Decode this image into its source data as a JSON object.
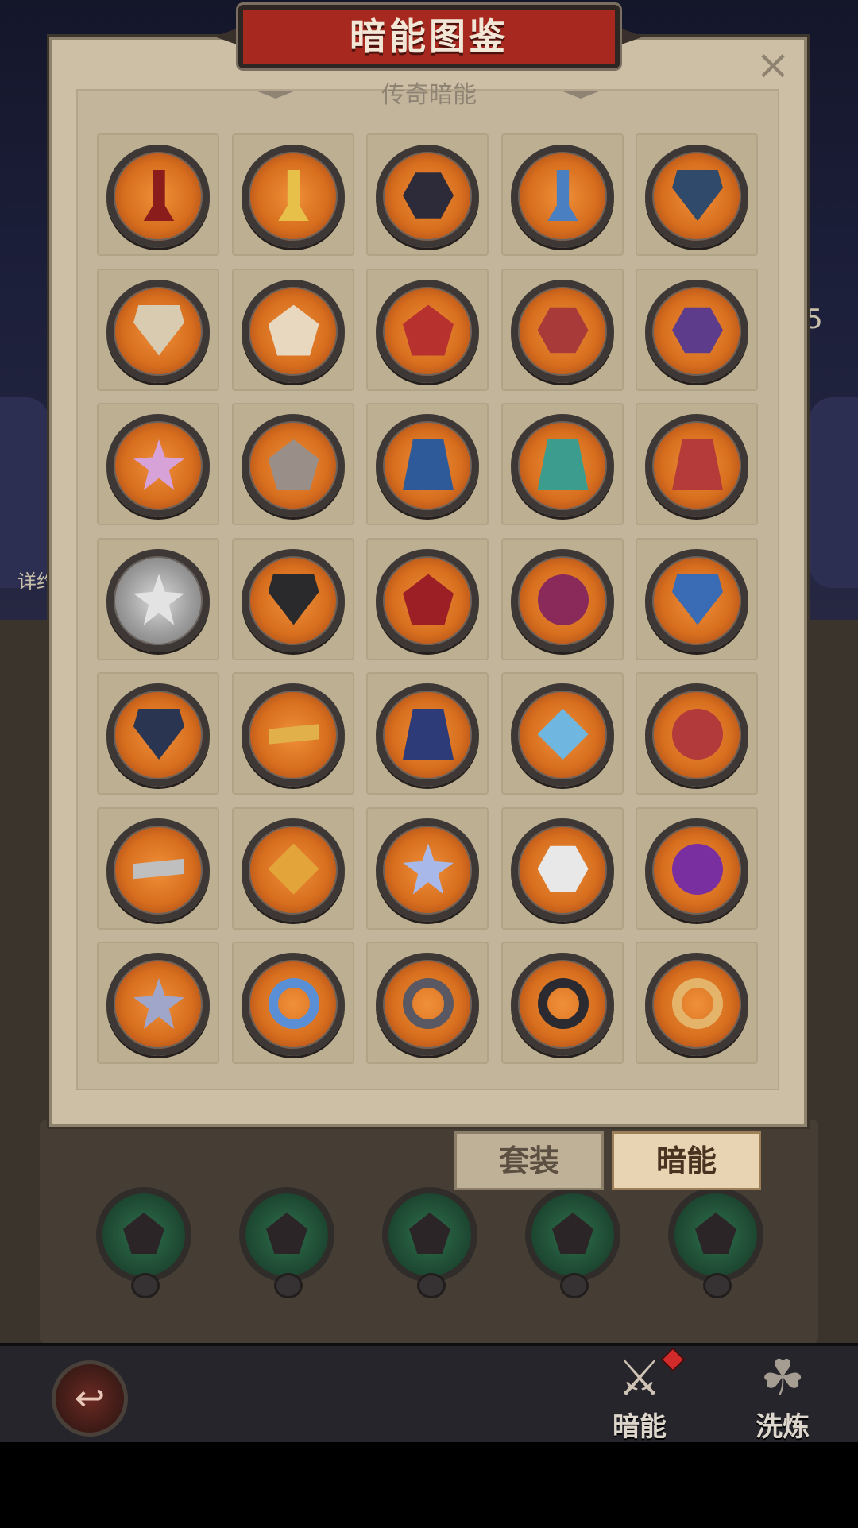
{
  "dialog": {
    "title": "暗能图鉴",
    "close_symbol": "×",
    "section_title": "传奇暗能"
  },
  "background": {
    "left_label": "详约",
    "right_label": "5"
  },
  "tabs": [
    {
      "label": "套装",
      "active": false
    },
    {
      "label": "暗能",
      "active": true
    }
  ],
  "bottom_nav": [
    {
      "label": "暗能",
      "icon": "dark-energy-icon",
      "active": true,
      "badge": true
    },
    {
      "label": "洗炼",
      "icon": "refine-icon",
      "active": false,
      "badge": false
    }
  ],
  "back_button": {
    "icon": "back-arrow-icon"
  },
  "grid": {
    "columns": 5,
    "rows": 7,
    "items": [
      {
        "name": "scepter",
        "shape": "tall",
        "color": "#8a1c1c",
        "badge": "orange"
      },
      {
        "name": "gold-key",
        "shape": "tall",
        "color": "#e7c04a",
        "badge": "orange"
      },
      {
        "name": "double-axe",
        "shape": "hex",
        "color": "#2d2a3a",
        "badge": "orange"
      },
      {
        "name": "sword",
        "shape": "tall",
        "color": "#4a7fc1",
        "badge": "orange"
      },
      {
        "name": "dark-helm",
        "shape": "shield",
        "color": "#2f4a6a",
        "badge": "orange"
      },
      {
        "name": "winged-helm",
        "shape": "shield",
        "color": "#d8cbb0",
        "badge": "orange"
      },
      {
        "name": "bone-mask",
        "shape": "pent",
        "color": "#e8d8c0",
        "badge": "orange"
      },
      {
        "name": "demon-mask",
        "shape": "pent",
        "color": "#b7322e",
        "badge": "orange"
      },
      {
        "name": "red-chest",
        "shape": "hex",
        "color": "#a83a3a",
        "badge": "orange"
      },
      {
        "name": "purple-armor",
        "shape": "hex",
        "color": "#5d3c8c",
        "badge": "orange"
      },
      {
        "name": "spiked-pauldron",
        "shape": "star",
        "color": "#d6a2d8",
        "badge": "orange"
      },
      {
        "name": "steel-pauldron",
        "shape": "pent",
        "color": "#9a8e88",
        "badge": "orange"
      },
      {
        "name": "blue-legs",
        "shape": "trap",
        "color": "#2f5a9a",
        "badge": "orange"
      },
      {
        "name": "teal-legs",
        "shape": "trap",
        "color": "#3c9c8e",
        "badge": "orange"
      },
      {
        "name": "red-greaves",
        "shape": "trap",
        "color": "#b53b3b",
        "badge": "orange"
      },
      {
        "name": "silver-crown",
        "shape": "star",
        "color": "#e3e3e3",
        "badge": "silver"
      },
      {
        "name": "iron-helm",
        "shape": "shield",
        "color": "#2a2a2c",
        "badge": "orange"
      },
      {
        "name": "red-horn-helm",
        "shape": "pent",
        "color": "#9c1f25",
        "badge": "orange"
      },
      {
        "name": "purple-fist",
        "shape": "round",
        "color": "#8a2a5a",
        "badge": "orange"
      },
      {
        "name": "blue-boot",
        "shape": "shield",
        "color": "#3a6bb5",
        "badge": "orange"
      },
      {
        "name": "dark-boot",
        "shape": "shield",
        "color": "#2a3552",
        "badge": "orange"
      },
      {
        "name": "gold-band",
        "shape": "bar",
        "color": "#e1b04a",
        "badge": "orange"
      },
      {
        "name": "gold-belt-cape",
        "shape": "trap",
        "color": "#2d3b78",
        "badge": "orange"
      },
      {
        "name": "blue-pendant",
        "shape": "diamond",
        "color": "#6fb6e0",
        "badge": "orange"
      },
      {
        "name": "chain-amulet",
        "shape": "round",
        "color": "#b23a3a",
        "badge": "orange"
      },
      {
        "name": "silver-chain",
        "shape": "bar",
        "color": "#bfbfbf",
        "badge": "orange"
      },
      {
        "name": "gold-chain",
        "shape": "diamond",
        "color": "#e3a43a",
        "badge": "orange"
      },
      {
        "name": "crystal-crest",
        "shape": "star",
        "color": "#a8b8e8",
        "badge": "orange"
      },
      {
        "name": "skull-wings",
        "shape": "hex",
        "color": "#e8e8e8",
        "badge": "orange"
      },
      {
        "name": "purple-crest",
        "shape": "round",
        "color": "#7a2fa0",
        "badge": "orange"
      },
      {
        "name": "star-ring",
        "shape": "star",
        "color": "#9fa6c9",
        "badge": "orange"
      },
      {
        "name": "sapphire-ring",
        "shape": "ring",
        "color": "#5a8fd6",
        "badge": "orange"
      },
      {
        "name": "serpent-ring",
        "shape": "ring",
        "color": "#5a5862",
        "badge": "orange"
      },
      {
        "name": "dark-ring",
        "shape": "ring",
        "color": "#2a2a30",
        "badge": "orange"
      },
      {
        "name": "gold-ring",
        "shape": "ring",
        "color": "#e3b46a",
        "badge": "orange"
      }
    ]
  },
  "background_items": [
    {
      "name": "green-slot-1"
    },
    {
      "name": "green-slot-2"
    },
    {
      "name": "green-slot-3"
    },
    {
      "name": "green-slot-4"
    },
    {
      "name": "green-slot-5"
    }
  ]
}
